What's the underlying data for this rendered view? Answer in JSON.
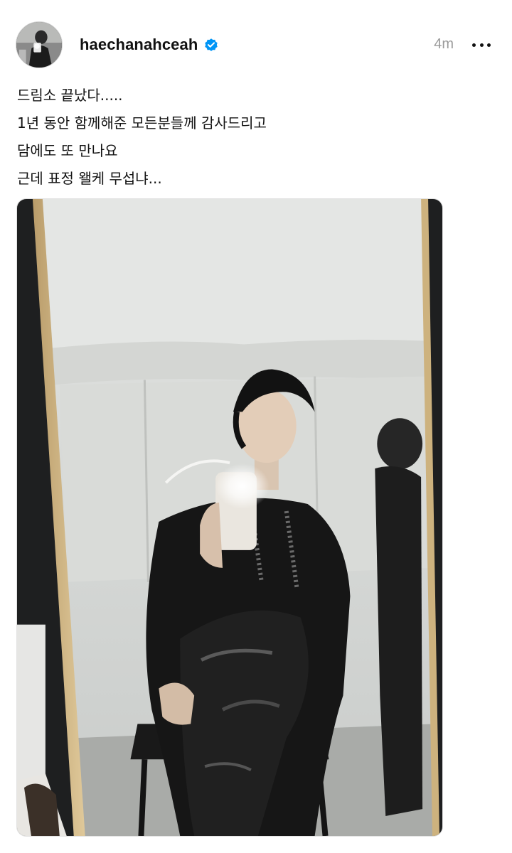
{
  "post": {
    "username": "haechanahceah",
    "verified_icon": "verified-badge-icon",
    "timestamp": "4m",
    "more_icon": "more-options-icon",
    "caption_lines": [
      "드림소 끝났다.....",
      "1년 동안 함께해준 모든분들께 감사드리고",
      "담에도 또 만나요",
      "근데 표정 왤케 무섭냐..."
    ]
  },
  "colors": {
    "verified_blue": "#0095f6",
    "timestamp_gray": "#9a9a9a",
    "text": "#121212"
  }
}
